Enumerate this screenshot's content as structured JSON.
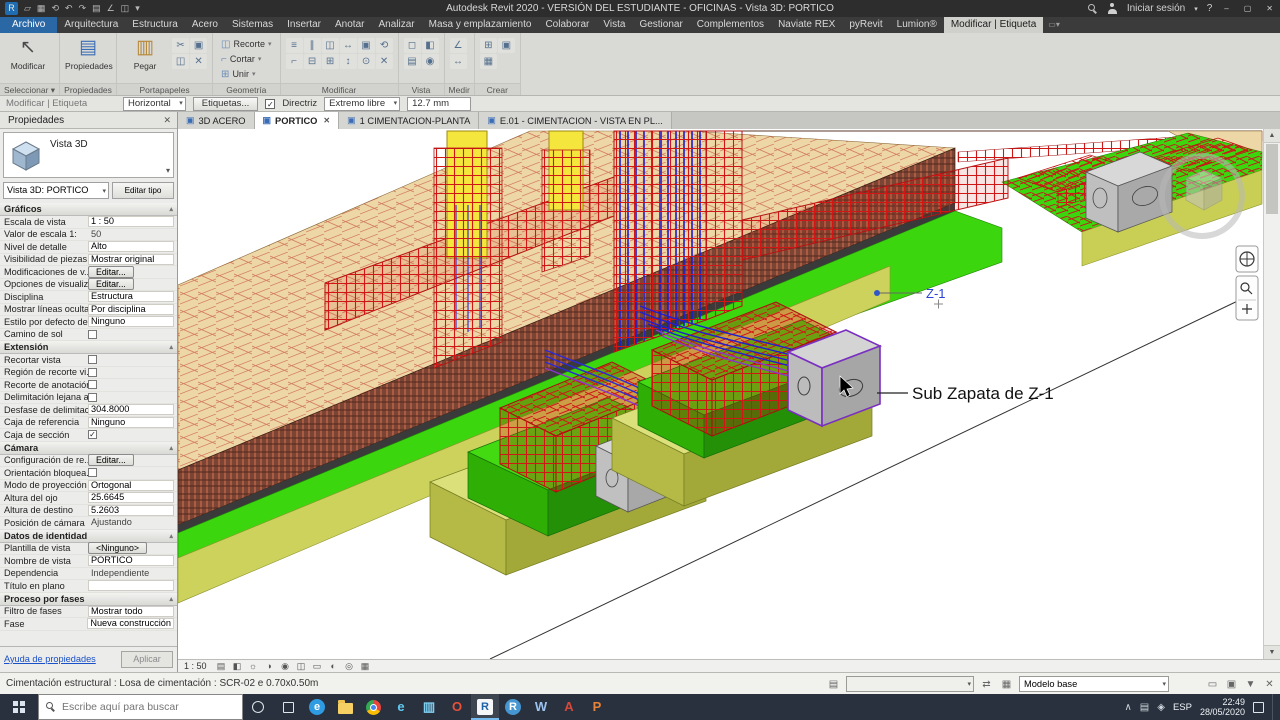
{
  "title_bar": {
    "title": "Autodesk Revit 2020 - VERSIÓN DEL ESTUDIANTE - OFICINAS - Vista 3D: PORTICO",
    "sign_in_label": "Iniciar sesión",
    "help_label": "?",
    "qat": [
      {
        "name": "app-menu-icon",
        "glyph": "R"
      },
      {
        "name": "open-icon",
        "glyph": "▱"
      },
      {
        "name": "save-icon",
        "glyph": "▦"
      },
      {
        "name": "sync-icon",
        "glyph": "⟲"
      },
      {
        "name": "undo-icon",
        "glyph": "↶"
      },
      {
        "name": "redo-icon",
        "glyph": "↷"
      },
      {
        "name": "print-icon",
        "glyph": "▤"
      },
      {
        "name": "measure-icon",
        "glyph": "∠"
      },
      {
        "name": "tag-icon",
        "glyph": "◫"
      },
      {
        "name": "qat-dropdown-icon",
        "glyph": "▾"
      }
    ]
  },
  "ribbon": {
    "file_tab": "Archivo",
    "tabs": [
      "Arquitectura",
      "Estructura",
      "Acero",
      "Sistemas",
      "Insertar",
      "Anotar",
      "Analizar",
      "Masa y emplazamiento",
      "Colaborar",
      "Vista",
      "Gestionar",
      "Complementos",
      "Naviate REX",
      "pyRevit",
      "Lumion®"
    ],
    "context_tab": "Modificar | Etiqueta",
    "panels": [
      {
        "label": "Seleccionar ▾",
        "bigs": [
          {
            "name": "modify-button",
            "glyph": "↖",
            "label": "Modificar",
            "color": "#4a4a4a"
          }
        ]
      },
      {
        "label": "Propiedades",
        "bigs": [
          {
            "name": "properties-button",
            "glyph": "▤",
            "label": "Propiedades",
            "color": "#3a6db5"
          }
        ]
      },
      {
        "label": "Portapapeles",
        "bigs": [
          {
            "name": "paste-button",
            "glyph": "▥",
            "label": "Pegar",
            "color": "#b5893a"
          }
        ],
        "grid": [
          {
            "name": "cut-icon",
            "glyph": "✂"
          },
          {
            "name": "copy-icon",
            "glyph": "▣"
          },
          {
            "name": "match-type-icon",
            "glyph": "◫"
          },
          {
            "name": "delete-icon",
            "glyph": "✕"
          }
        ],
        "cols": 2
      },
      {
        "label": "Geometría",
        "rows": [
          {
            "name": "crop-button",
            "glyph": "◫",
            "label": "Recorte",
            "caret": true
          },
          {
            "name": "cut-geometry-button",
            "glyph": "⌐",
            "label": "Cortar",
            "caret": true
          },
          {
            "name": "join-button",
            "glyph": "⊞",
            "label": "Unir",
            "caret": true
          }
        ]
      },
      {
        "label": "Modificar",
        "cols": 6,
        "grid": [
          {
            "name": "align-icon",
            "glyph": "≡"
          },
          {
            "name": "offset-icon",
            "glyph": "∥"
          },
          {
            "name": "mirror-icon",
            "glyph": "◫"
          },
          {
            "name": "move-icon",
            "glyph": "↔"
          },
          {
            "name": "copy-tool-icon",
            "glyph": "▣"
          },
          {
            "name": "rotate-icon",
            "glyph": "⟲"
          },
          {
            "name": "trim-icon",
            "glyph": "⌐"
          },
          {
            "name": "split-icon",
            "glyph": "⊟"
          },
          {
            "name": "array-icon",
            "glyph": "⊞"
          },
          {
            "name": "scale-icon",
            "glyph": "↕"
          },
          {
            "name": "pin-icon",
            "glyph": "⊙"
          },
          {
            "name": "delete-tool-icon",
            "glyph": "✕"
          }
        ]
      },
      {
        "label": "Vista",
        "cols": 2,
        "grid": [
          {
            "name": "wireframe-icon",
            "glyph": "◻"
          },
          {
            "name": "hidden-line-icon",
            "glyph": "◧"
          },
          {
            "name": "section-view-icon",
            "glyph": "▤"
          },
          {
            "name": "camera-icon",
            "glyph": "◉"
          }
        ]
      },
      {
        "label": "Medir",
        "cols": 1,
        "grid": [
          {
            "name": "measure-tool-icon",
            "glyph": "∠"
          },
          {
            "name": "dimension-icon",
            "glyph": "↔"
          }
        ]
      },
      {
        "label": "Crear",
        "cols": 2,
        "grid": [
          {
            "name": "create-group-icon",
            "glyph": "⊞"
          },
          {
            "name": "create-similar-icon",
            "glyph": "▣"
          },
          {
            "name": "load-family-icon",
            "glyph": "▦"
          }
        ]
      }
    ]
  },
  "options_bar": {
    "context_label": "Modificar | Etiqueta",
    "orientation_value": "Horizontal",
    "tags_button": "Etiquetas...",
    "leader_checkbox_label": "Directriz",
    "leader_checked": "✓",
    "attach_value": "Extremo libre",
    "offset_value": "12.7 mm"
  },
  "properties": {
    "header_title": "Propiedades",
    "close_glyph": "✕",
    "type_name": "Vista 3D",
    "selector_value": "Vista 3D: PORTICO",
    "edit_type_label": "Editar tipo",
    "help_link": "Ayuda de propiedades",
    "apply_label": "Aplicar",
    "sections": [
      {
        "title": "Gráficos",
        "rows": [
          {
            "label": "Escala de vista",
            "value": "1 : 50",
            "type": "combo"
          },
          {
            "label": "Valor de escala  1:",
            "value": "50",
            "type": "text",
            "disabled": true
          },
          {
            "label": "Nivel de detalle",
            "value": "Alto",
            "type": "combo"
          },
          {
            "label": "Visibilidad de piezas",
            "value": "Mostrar original",
            "type": "combo"
          },
          {
            "label": "Modificaciones de v...",
            "value": "Editar...",
            "type": "button"
          },
          {
            "label": "Opciones de visualiz...",
            "value": "Editar...",
            "type": "button"
          },
          {
            "label": "Disciplina",
            "value": "Estructura",
            "type": "combo"
          },
          {
            "label": "Mostrar líneas ocultas",
            "value": "Por disciplina",
            "type": "combo"
          },
          {
            "label": "Estilo por defecto de...",
            "value": "Ninguno",
            "type": "combo"
          },
          {
            "label": "Camino de sol",
            "type": "check",
            "checked": false
          }
        ]
      },
      {
        "title": "Extensión",
        "rows": [
          {
            "label": "Recortar vista",
            "type": "check",
            "checked": false
          },
          {
            "label": "Región de recorte vi...",
            "type": "check",
            "checked": false
          },
          {
            "label": "Recorte de anotación",
            "type": "check",
            "checked": false
          },
          {
            "label": "Delimitación lejana a...",
            "type": "check",
            "checked": false
          },
          {
            "label": "Desfase de delimitac...",
            "value": "304.8000",
            "type": "text"
          },
          {
            "label": "Caja de referencia",
            "value": "Ninguno",
            "type": "combo"
          },
          {
            "label": "Caja de sección",
            "type": "check",
            "checked": true
          }
        ]
      },
      {
        "title": "Cámara",
        "rows": [
          {
            "label": "Configuración de re...",
            "value": "Editar...",
            "type": "button"
          },
          {
            "label": "Orientación bloquea...",
            "type": "check",
            "checked": false
          },
          {
            "label": "Modo de proyección",
            "value": "Ortogonal",
            "type": "combo"
          },
          {
            "label": "Altura del ojo",
            "value": "25.6645",
            "type": "text"
          },
          {
            "label": "Altura de destino",
            "value": "5.2603",
            "type": "text"
          },
          {
            "label": "Posición de cámara",
            "value": "Ajustando",
            "type": "text",
            "disabled": true
          }
        ]
      },
      {
        "title": "Datos de identidad",
        "rows": [
          {
            "label": "Plantilla de vista",
            "value": "<Ninguno>",
            "type": "button"
          },
          {
            "label": "Nombre de vista",
            "value": "PORTICO",
            "type": "text"
          },
          {
            "label": "Dependencia",
            "value": "Independiente",
            "type": "text",
            "disabled": true
          },
          {
            "label": "Título en plano",
            "value": "",
            "type": "text"
          }
        ]
      },
      {
        "title": "Proceso por fases",
        "rows": [
          {
            "label": "Filtro de fases",
            "value": "Mostrar todo",
            "type": "combo"
          },
          {
            "label": "Fase",
            "value": "Nueva construcción",
            "type": "combo"
          }
        ]
      }
    ]
  },
  "view_tabs": [
    {
      "label": "3D ACERO",
      "active": false,
      "closable": false
    },
    {
      "label": "PORTICO",
      "active": true,
      "closable": true
    },
    {
      "label": "1 CIMENTACION-PLANTA",
      "active": false,
      "closable": false
    },
    {
      "label": "E.01 - CIMENTACION - VISTA EN PL...",
      "active": false,
      "closable": false
    }
  ],
  "viewport": {
    "tag_z1": "Z-1",
    "note_text": "Sub Zapata de Z-1",
    "colors": {
      "slab_tan": "#eed7a6",
      "rebar_red": "#d11616",
      "footing_green": "#44da12",
      "subfooting_olive": "#dce07a",
      "column_yellow": "#f4e63c",
      "vertical_rebar_blue": "#1b1bd6",
      "selection_purple": "#7a2fc0"
    }
  },
  "view_control_bar": {
    "scale": "1 : 50",
    "icons": [
      {
        "name": "detail-level-icon",
        "glyph": "▤"
      },
      {
        "name": "visual-style-icon",
        "glyph": "◧"
      },
      {
        "name": "sun-path-icon",
        "glyph": "☼"
      },
      {
        "name": "shadows-icon",
        "glyph": "◑"
      },
      {
        "name": "rendering-icon",
        "glyph": "◉"
      },
      {
        "name": "crop-view-icon",
        "glyph": "◫"
      },
      {
        "name": "show-crop-icon",
        "glyph": "▭"
      },
      {
        "name": "temporary-hide-icon",
        "glyph": "◐"
      },
      {
        "name": "reveal-hidden-icon",
        "glyph": "◎"
      },
      {
        "name": "analytical-model-icon",
        "glyph": "▦"
      }
    ]
  },
  "status_bar": {
    "message": "Cimentación estructural : Losa de cimentación : SCR-02 e 0.70x0.50m",
    "workset_value": "",
    "design_option_value": "Modelo base",
    "icons_a": [
      {
        "name": "worksets-icon",
        "glyph": "▤"
      }
    ],
    "icons_b": [
      {
        "name": "editing-requests-icon",
        "glyph": "⇄"
      }
    ],
    "icons_c": [
      {
        "name": "design-options-icon",
        "glyph": "▦"
      }
    ],
    "icons_right": [
      {
        "name": "exclude-options-icon",
        "glyph": "▭"
      },
      {
        "name": "editable-only-icon",
        "glyph": "▣"
      },
      {
        "name": "filter-icon",
        "glyph": "▼"
      },
      {
        "name": "deselect-icon",
        "glyph": "✕"
      }
    ]
  },
  "taskbar": {
    "search_placeholder": "Escribe aquí para buscar",
    "apps": [
      {
        "name": "edge",
        "glyph": "e",
        "fg": "#ffffff",
        "bg": "#2f9be0",
        "shape": "circle"
      },
      {
        "name": "file-explorer",
        "shape": "folder"
      },
      {
        "name": "chrome",
        "shape": "chrome"
      },
      {
        "name": "internet-explorer",
        "glyph": "e",
        "fg": "#62c9f0",
        "shape": "plain"
      },
      {
        "name": "store",
        "glyph": "▥",
        "fg": "#7fd0f5",
        "shape": "plain"
      },
      {
        "name": "opera",
        "glyph": "O",
        "fg": "#e8503a",
        "shape": "plain"
      },
      {
        "name": "revit",
        "glyph": "R",
        "fg": "#1b62a8",
        "bg": "#f4f6f8",
        "shape": "square",
        "active": true
      },
      {
        "name": "rstudio",
        "glyph": "R",
        "fg": "#ffffff",
        "bg": "#4596d1",
        "shape": "circle"
      },
      {
        "name": "word",
        "glyph": "W",
        "fg": "#9cc3f0",
        "shape": "plain"
      },
      {
        "name": "autocad",
        "glyph": "A",
        "fg": "#d8473a",
        "shape": "plain"
      },
      {
        "name": "powerpoint",
        "glyph": "P",
        "fg": "#e8833a",
        "shape": "plain"
      }
    ],
    "tray": {
      "chevron": "∧",
      "lang": "ESP",
      "time": "22:49",
      "date": "28/05/2020"
    }
  }
}
